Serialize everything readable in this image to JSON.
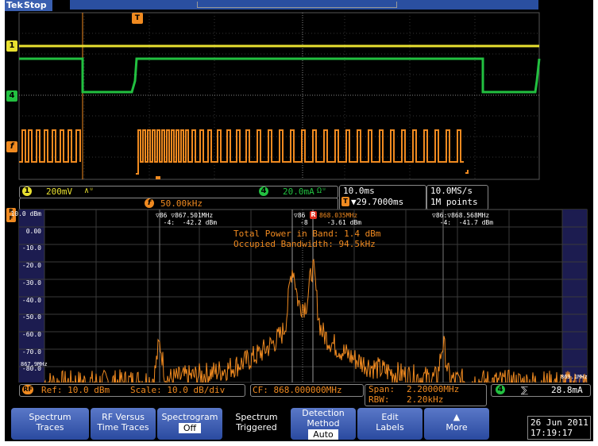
{
  "top": {
    "brand": "Tek",
    "run_state": "Stop",
    "trigger_marker": "T"
  },
  "channels": [
    {
      "badge": "1",
      "color": "#e8e030"
    },
    {
      "badge": "4",
      "color": "#22c040"
    },
    {
      "badge": "f",
      "color": "#f08a20"
    }
  ],
  "readouts": {
    "ch1_scale": "200mV",
    "ch1_coupling": "∧ᵘ",
    "ch4_scale": "20.0mA",
    "ch4_extra": "Ωᵘ",
    "freq": "50.00kHz",
    "timebase": "10.0ms",
    "trigger_pos": "▼29.7000ms",
    "sample_rate": "10.0MS/s",
    "record_length": "1M points"
  },
  "rf": {
    "r_label": "R",
    "f_label": "F",
    "db_ticks": [
      "10.0 dBm",
      "0.00",
      "-10.0",
      "-20.0",
      "-30.0",
      "-40.0",
      "-50.0",
      "-60.0",
      "-70.0",
      "-80.0"
    ],
    "left_freq": "867.9MHz",
    "right_freq": "869.1MHz",
    "marker_left": "▽86 ▽867.501MHz\n  -4:  -42.2 dBm",
    "marker_center": "▽86",
    "marker_center_r": "R",
    "marker_center_ref": "868.035MHz",
    "marker_center_sub": "-8     -3.61 dBm",
    "marker_right": "▽86:▽868.568MHz\n  -4:  -41.7 dBm",
    "total_power": "Total Power in Band: 1.4 dBm",
    "occupied_bw": "Occupied Bandwidth: 94.5kHz"
  },
  "rf_readouts": {
    "ref": "Ref: 10.0 dBm",
    "scale": "Scale: 10.0 dB/div",
    "cf": "CF: 868.000000MHz",
    "span_label": "Span:",
    "span": "2.20000MHz",
    "rbw_label": "RBW:",
    "rbw": "2.20kHz",
    "ch4_badge": "4",
    "edge_symbol": "⅀",
    "ch4_level": "28.8mA"
  },
  "softkeys": [
    {
      "line1": "Spectrum",
      "line2": "Traces"
    },
    {
      "line1": "RF Versus",
      "line2": "Time Traces"
    },
    {
      "line1": "Spectrogram",
      "sub": "Off"
    },
    {
      "line1": "Spectrum",
      "line2": "Triggered"
    },
    {
      "line1": "Detection",
      "line2": "Method",
      "sub": "Auto"
    },
    {
      "line1": "Edit",
      "line2": "Labels"
    },
    {
      "line1": "More"
    }
  ],
  "datetime": {
    "date": "26 Jun 2011",
    "time": "17:19:17"
  }
}
